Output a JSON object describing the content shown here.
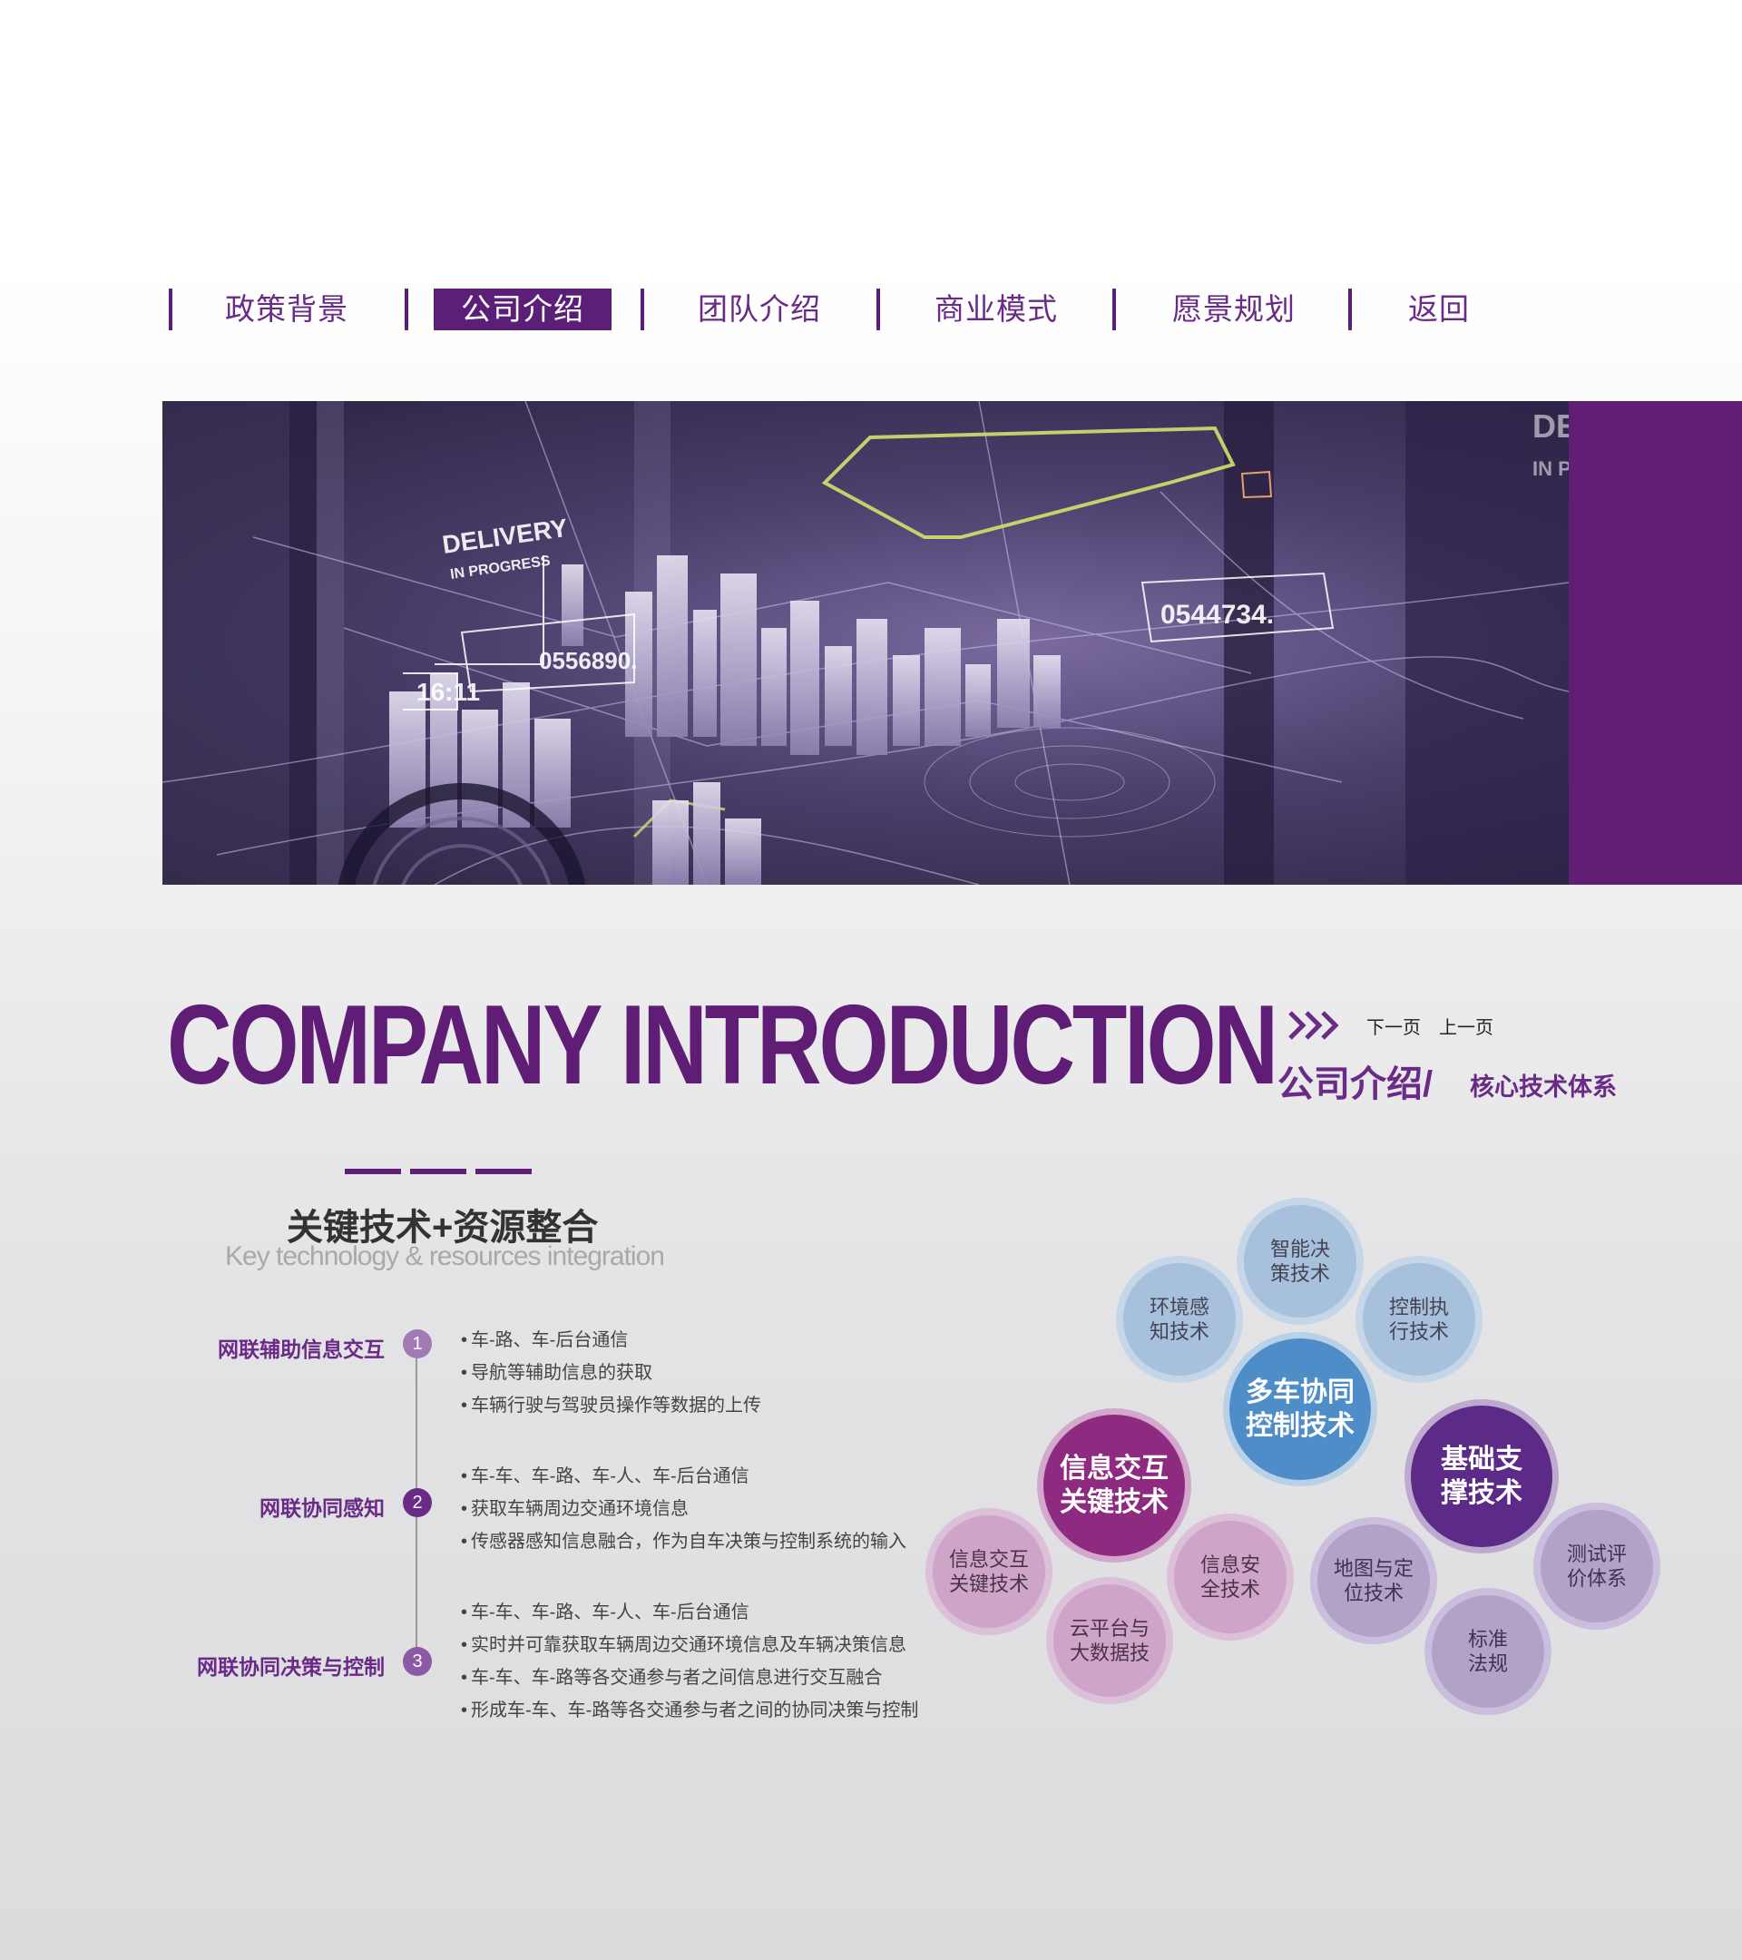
{
  "nav": {
    "items": [
      {
        "label": "政策背景"
      },
      {
        "label": "公司介绍"
      },
      {
        "label": "团队介绍"
      },
      {
        "label": "商业模式"
      },
      {
        "label": "愿景规划"
      },
      {
        "label": "返回"
      }
    ],
    "active": "公司介绍"
  },
  "banner": {
    "hud_1": "DELIVERY",
    "hud_2": "IN PROGRESS",
    "hud_time": "16:11",
    "hud_order_1": "0556890.",
    "hud_order_2": "0544734.",
    "hud_side": "DE",
    "hud_side_2": "IN P"
  },
  "title": {
    "main": "COMPANY INTRODUCTION",
    "next": "下一页",
    "prev": "上一页",
    "sub": "公司介绍/",
    "sub_small": "核心技术体系"
  },
  "section": {
    "heading": "关键技术+资源整合",
    "subheading": "Key technology  &  resources integration",
    "items": [
      {
        "label": "网联辅助信息交互",
        "num": "1",
        "bullets": [
          "车-路、车-后台通信",
          "导航等辅助信息的获取",
          "车辆行驶与驾驶员操作等数据的上传"
        ]
      },
      {
        "label": "网联协同感知",
        "num": "2",
        "bullets": [
          "车-车、车-路、车-人、车-后台通信",
          "获取车辆周边交通环境信息",
          "传感器感知信息融合，作为自车决策与控制系统的输入"
        ]
      },
      {
        "label": "网联协同决策与控制",
        "num": "3",
        "bullets": [
          "车-车、车-路、车-人、车-后台通信",
          "实时并可靠获取车辆周边交通环境信息及车辆决策信息",
          "车-车、车-路等各交通参与者之间信息进行交互融合",
          "形成车-车、车-路等各交通参与者之间的协同决策与控制"
        ]
      }
    ]
  },
  "bubbles": {
    "center_blue": "多车协同控制技术",
    "blue": [
      "智能决策技术",
      "环境感知技术",
      "控制执行技术"
    ],
    "center_pink": "信息交互关键技术",
    "pink": [
      "信息交互关键技术",
      "信息安全技术",
      "云平台与大数据技"
    ],
    "center_violet": "基础支撑技术",
    "violet": [
      "地图与定位技术",
      "测试评价体系",
      "标准法规"
    ]
  },
  "colors": {
    "accent": "#611e75",
    "num1": "#a079b5",
    "num2": "#6a2a87",
    "num3": "#8a5aa6"
  }
}
